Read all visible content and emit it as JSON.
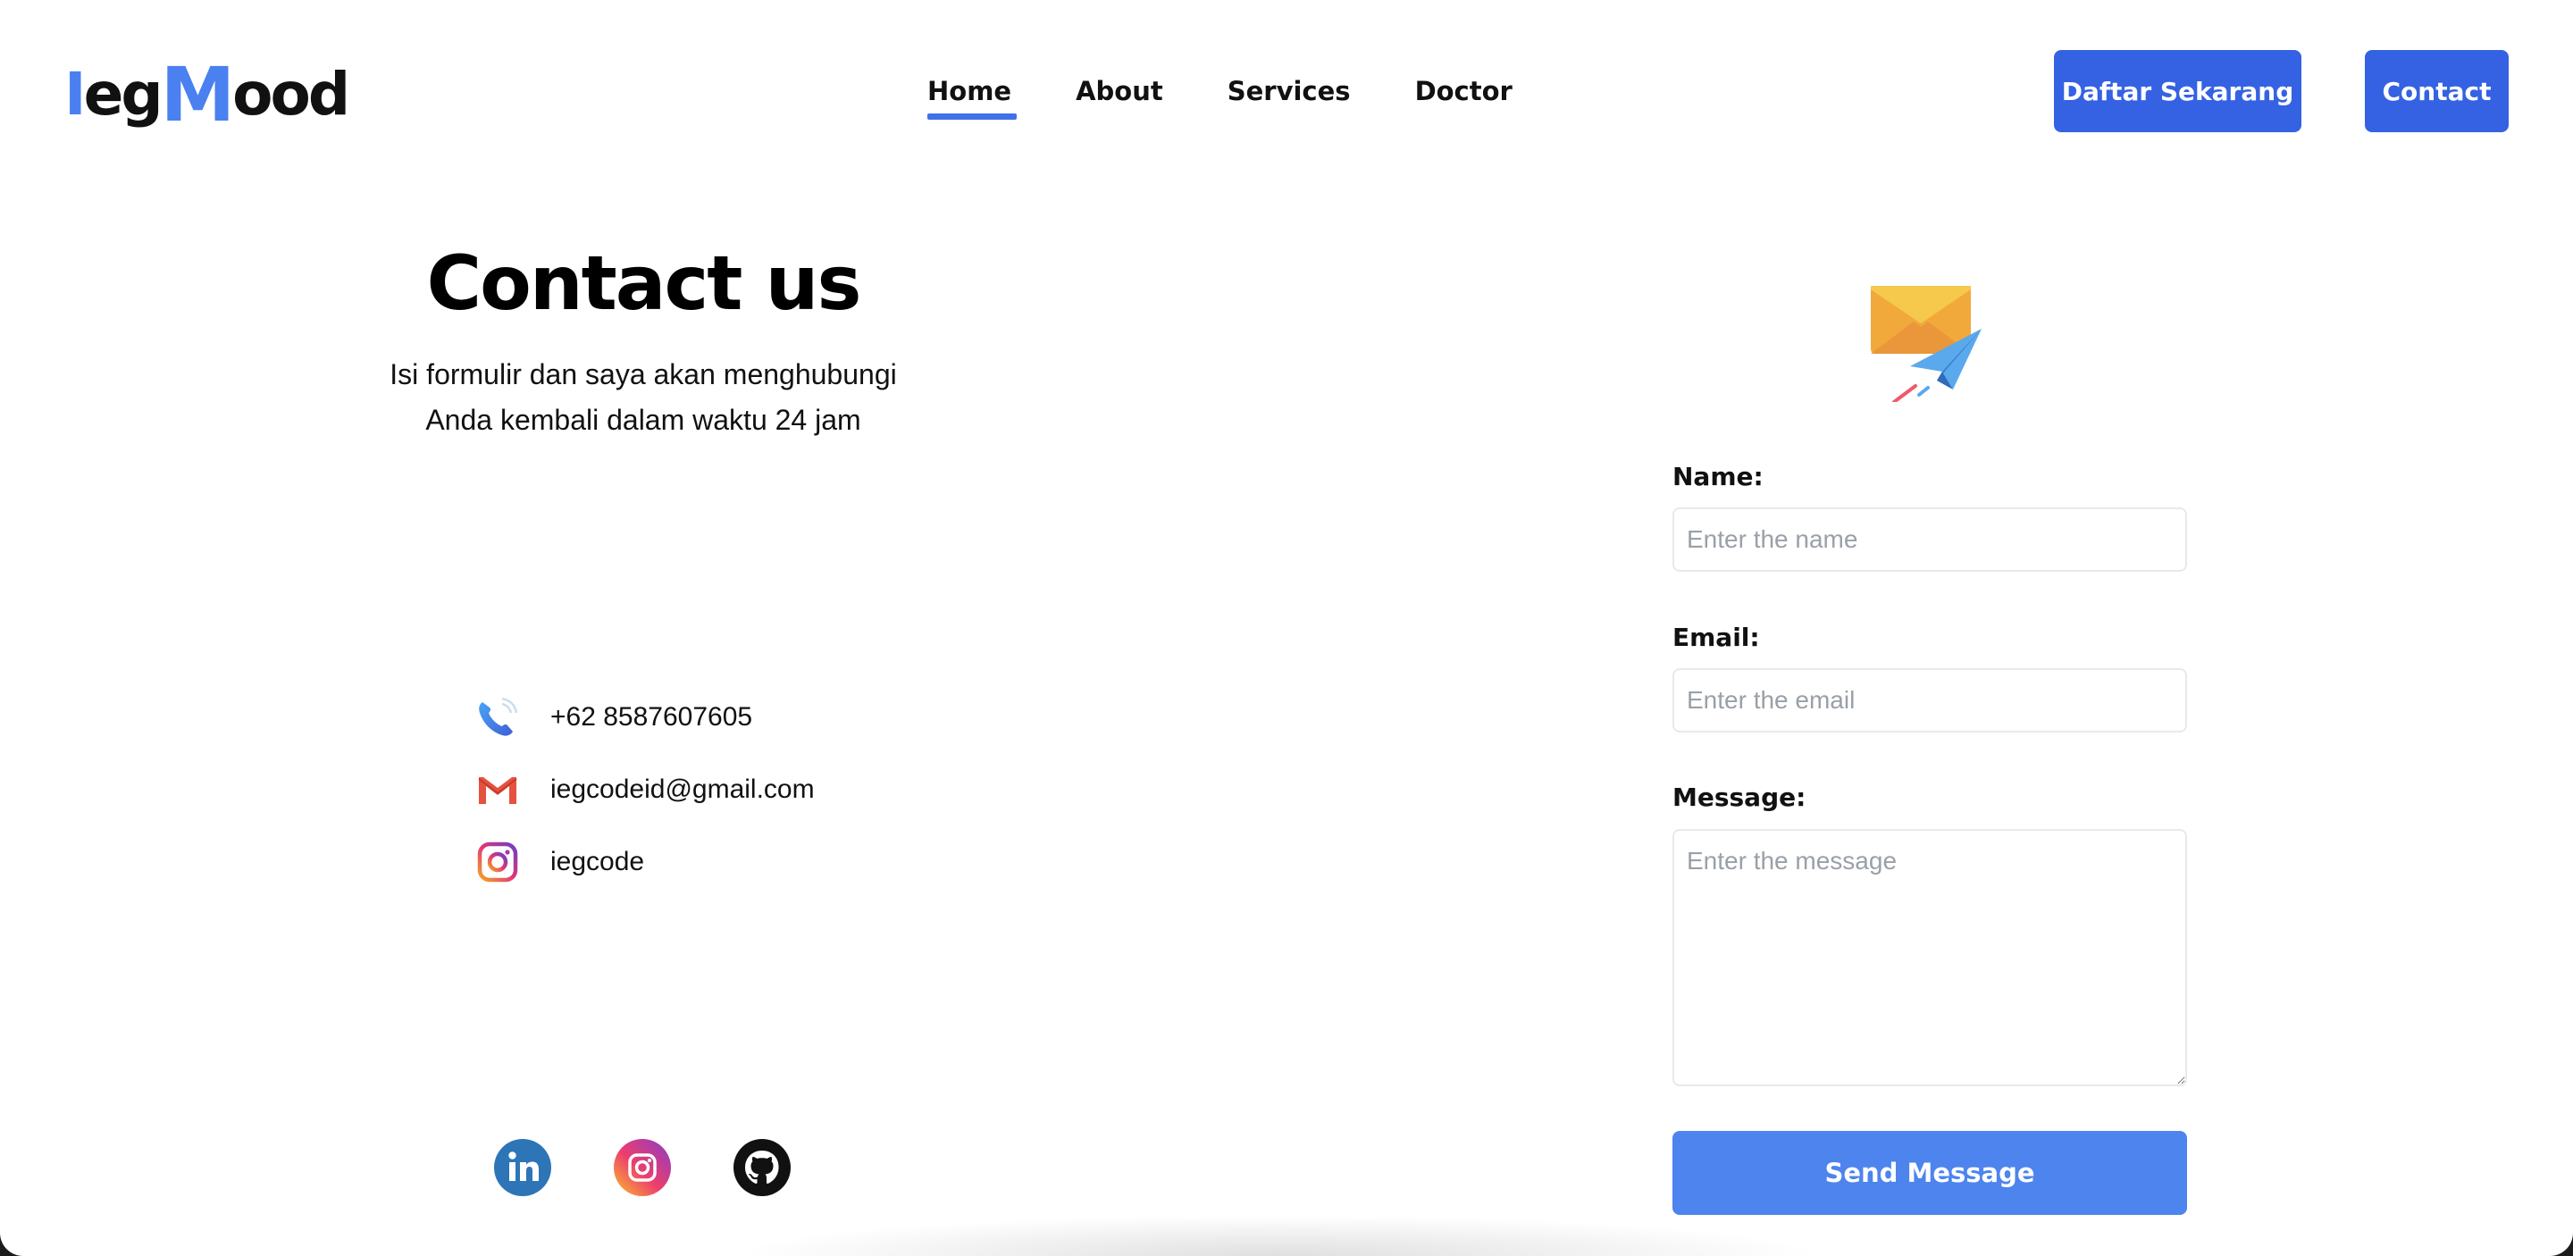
{
  "navbar": {
    "logo": {
      "part1": "I",
      "part2": "eg",
      "part3": "M",
      "part4": "ood"
    },
    "links": [
      {
        "label": "Home"
      },
      {
        "label": "About"
      },
      {
        "label": "Services"
      },
      {
        "label": "Doctor"
      }
    ],
    "active_link": "Home",
    "register_button": "Daftar Sekarang",
    "contact_button": "Contact"
  },
  "hero": {
    "title": "Contact us",
    "subtitle_line1": "Isi formulir dan saya akan menghubungi",
    "subtitle_line2": "Anda kembali dalam waktu 24 jam"
  },
  "contacts": [
    {
      "icon": "phone-icon",
      "text": "+62 8587607605"
    },
    {
      "icon": "gmail-icon",
      "text": "iegcodeid@gmail.com"
    },
    {
      "icon": "instagram-icon",
      "text": "iegcode"
    }
  ],
  "socials": [
    "linkedin-icon",
    "instagram-icon",
    "github-icon"
  ],
  "form": {
    "name_label": "Name:",
    "name_placeholder": "Enter the name",
    "email_label": "Email:",
    "email_placeholder": "Enter the email",
    "message_label": "Message:",
    "message_placeholder": "Enter the message",
    "submit_label": "Send Message"
  },
  "colors": {
    "accent": "#3562e3",
    "logo_accent": "#4a80f0",
    "send_button": "#4d84ee"
  }
}
